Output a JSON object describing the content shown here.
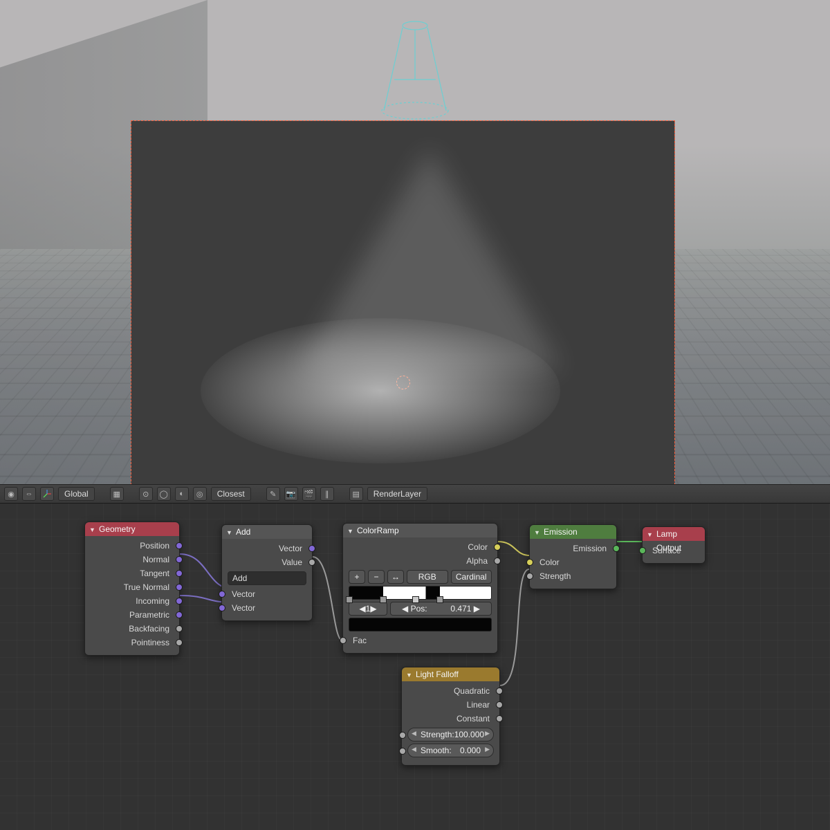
{
  "header": {
    "transform_orientation": "Global",
    "snap_mode": "Closest",
    "render_layer": "RenderLayer",
    "icons": [
      "editor-type-icon",
      "expand-icon",
      "axes-icon",
      "pivot-icon",
      "manipulator-icon",
      "layers-icon",
      "snap-icon",
      "snap-magnet-icon",
      "proportional-icon",
      "render-icon",
      "animation-icon",
      "pause-icon",
      "renderlayer-icon"
    ]
  },
  "nodes": {
    "geometry": {
      "title": "Geometry",
      "outputs": [
        "Position",
        "Normal",
        "Tangent",
        "True Normal",
        "Incoming",
        "Parametric",
        "Backfacing",
        "Pointiness"
      ]
    },
    "add": {
      "title": "Add",
      "outputs": [
        "Vector",
        "Value"
      ],
      "operation_label": "Add",
      "inputs": [
        "Vector",
        "Vector"
      ]
    },
    "color_ramp": {
      "title": "ColorRamp",
      "outputs": [
        "Color",
        "Alpha"
      ],
      "mode_a": "RGB",
      "mode_b": "Cardinal",
      "index": "1",
      "pos_label": "Pos:",
      "pos_value": "0.471",
      "input": "Fac",
      "stops": [
        0,
        0.24,
        0.47,
        0.64
      ]
    },
    "light_falloff": {
      "title": "Light Falloff",
      "outputs": [
        "Quadratic",
        "Linear",
        "Constant"
      ],
      "strength_label": "Strength:",
      "strength_value": "100.000",
      "smooth_label": "Smooth:",
      "smooth_value": "0.000"
    },
    "emission": {
      "title": "Emission",
      "output": "Emission",
      "inputs": [
        "Color",
        "Strength"
      ]
    },
    "lamp_output": {
      "title": "Lamp Output",
      "input": "Surface"
    }
  }
}
